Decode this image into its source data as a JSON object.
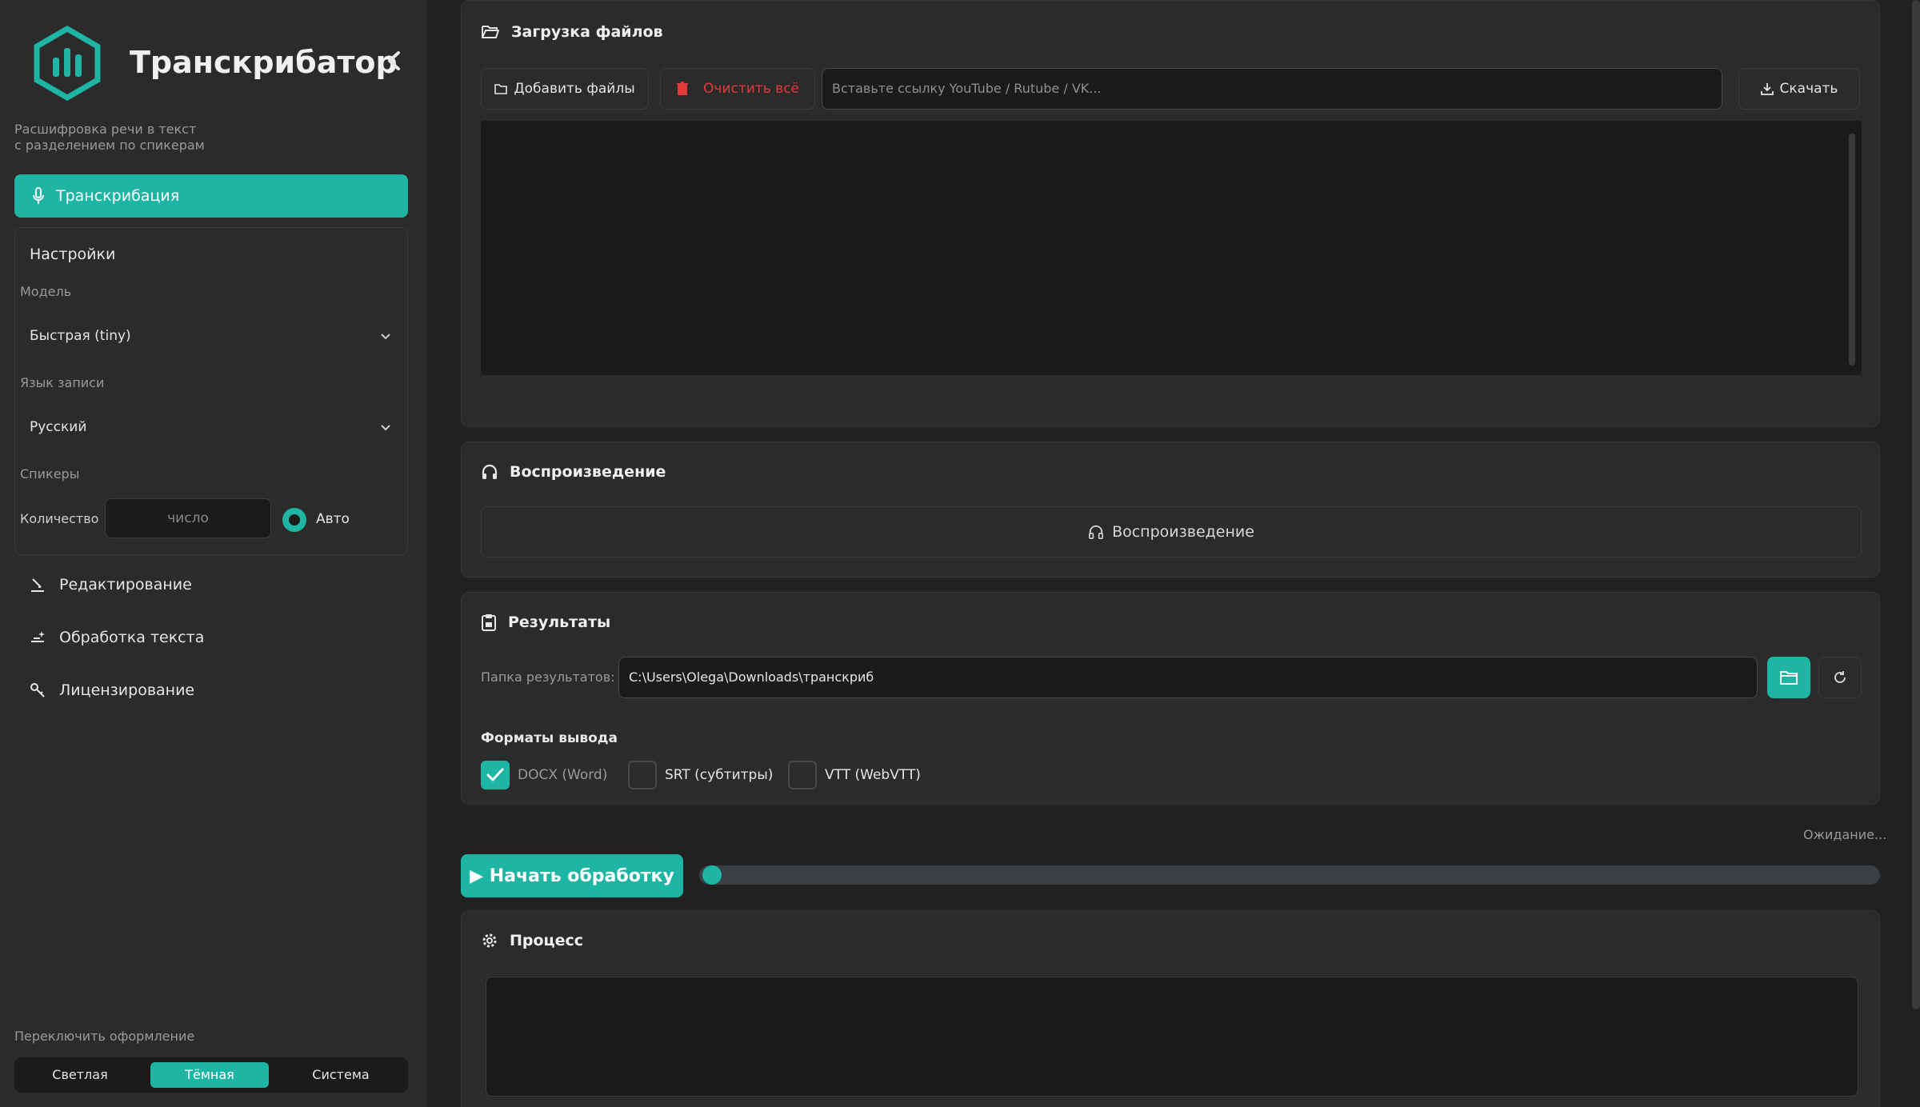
{
  "sidebar": {
    "app_title": "Транскрибатор",
    "subtitle_line1": "Расшифровка речи в текст",
    "subtitle_line2": "с разделением по спикерам",
    "active_nav": "Транскрибация",
    "settings": {
      "title": "Настройки",
      "model_label": "Модель",
      "model_value": "Быстрая (tiny)",
      "language_label": "Язык записи",
      "language_value": "Русский",
      "speakers_label": "Спикеры",
      "count_label": "Количество",
      "count_placeholder": "число",
      "auto_label": "Авто"
    },
    "nav_items": [
      "Редактирование",
      "Обработка текста",
      "Лицензирование"
    ],
    "theme": {
      "label": "Переключить оформление",
      "options": [
        "Светлая",
        "Тёмная",
        "Система"
      ],
      "selected": "Тёмная"
    }
  },
  "upload": {
    "title": "Загрузка файлов",
    "add_files": "Добавить файлы",
    "clear_all": "Очистить всё",
    "url_placeholder": "Вставьте ссылку YouTube / Rutube / VK...",
    "download": "Скачать"
  },
  "playback": {
    "title": "Воспроизведение",
    "bar_label": "Воспроизведение"
  },
  "results": {
    "title": "Результаты",
    "folder_label": "Папка результатов:",
    "folder_path": "C:\\Users\\Olega\\Downloads\\транскриб",
    "formats_title": "Форматы вывода",
    "formats": [
      {
        "label": "DOCX (Word)",
        "checked": true
      },
      {
        "label": "SRT (субтитры)",
        "checked": false
      },
      {
        "label": "VTT (WebVTT)",
        "checked": false
      }
    ]
  },
  "status": "Ожидание...",
  "start_button": "▶ Начать обработку",
  "progress_percent": 0,
  "process": {
    "title": "Процесс"
  },
  "colors": {
    "accent": "#1eb5a5",
    "danger": "#e03a3a",
    "background": "#212121",
    "panel": "#2b2b2b"
  }
}
